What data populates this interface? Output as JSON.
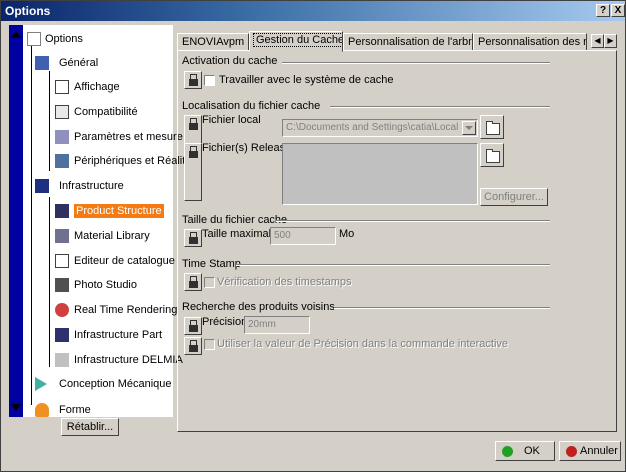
{
  "window": {
    "title": "Options",
    "help_button": "?",
    "close_button": "X"
  },
  "tree": {
    "root": "Options",
    "items": [
      {
        "label": "Général"
      },
      {
        "label": "Affichage"
      },
      {
        "label": "Compatibilité"
      },
      {
        "label": "Paramètres et mesure"
      },
      {
        "label": "Périphériques et Réalit"
      },
      {
        "label": "Infrastructure"
      },
      {
        "label": "Product Structure"
      },
      {
        "label": "Material Library"
      },
      {
        "label": "Editeur de catalogue"
      },
      {
        "label": "Photo Studio"
      },
      {
        "label": "Real Time Rendering"
      },
      {
        "label": "Infrastructure Part"
      },
      {
        "label": "Infrastructure DELMIA"
      },
      {
        "label": "Conception Mécanique"
      },
      {
        "label": "Forme"
      }
    ],
    "selected": "Product Structure",
    "selected_color": "#f47a14",
    "scrollbar_color": "#0000a0"
  },
  "reset_button": "Rétablir...",
  "tabs": [
    {
      "label": "ENOVIAvpm"
    },
    {
      "label": "Gestion du Cache"
    },
    {
      "label": "Personnalisation de l'arbre"
    },
    {
      "label": "Personnalisation des noe"
    }
  ],
  "active_tab": "Gestion du Cache",
  "sections": {
    "activation": {
      "title": "Activation du cache",
      "checkbox_label": "Travailler avec le système de cache"
    },
    "localisation": {
      "title": "Localisation du fichier cache",
      "local_label": "Fichier local",
      "local_value": "C:\\Documents and Settings\\catia\\Local Se",
      "release_label": "Fichier(s) Release",
      "configure_button": "Configurer..."
    },
    "taille": {
      "title": "Taille du fichier cache",
      "max_label": "Taille maximale",
      "max_value": "500",
      "unit": "Mo"
    },
    "timestamp": {
      "title": "Time Stamp",
      "checkbox_label": "Vérification des timestamps"
    },
    "voisins": {
      "title": "Recherche des produits voisins",
      "precision_label": "Précision",
      "precision_value": "20mm",
      "checkbox_label": "Utiliser la valeur de Précision dans la commande interactive"
    }
  },
  "footer": {
    "ok_label": "OK",
    "cancel_label": "Annuler",
    "ok_color": "#20a020",
    "cancel_color": "#c02020"
  }
}
